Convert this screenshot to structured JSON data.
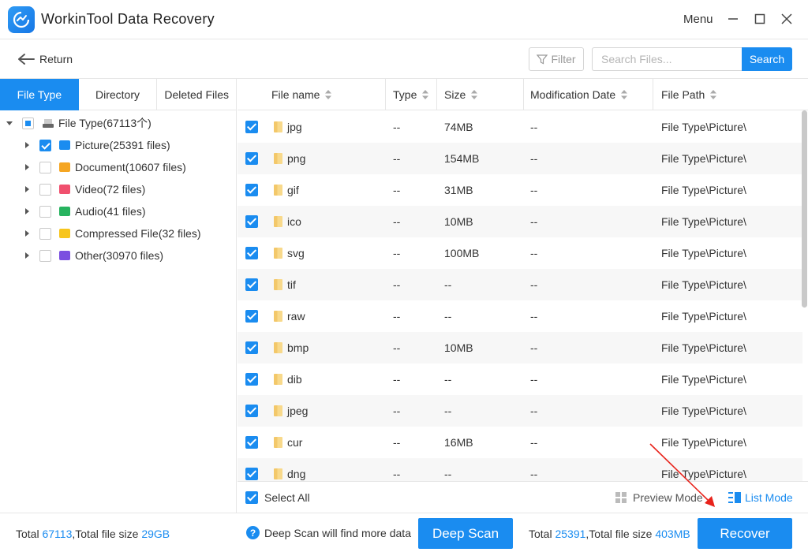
{
  "app": {
    "title": "WorkinTool Data Recovery",
    "menu_label": "Menu"
  },
  "toolbar": {
    "return_label": "Return",
    "filter_label": "Filter",
    "search_placeholder": "Search Files...",
    "search_label": "Search"
  },
  "tabs": [
    {
      "label": "File Type",
      "active": true
    },
    {
      "label": "Directory",
      "active": false
    },
    {
      "label": "Deleted Files",
      "active": false
    }
  ],
  "tree": {
    "root_label": "File Type(67113个)",
    "items": [
      {
        "label": "Picture(25391 files)",
        "checked": true,
        "icon": "picture-icon",
        "color": "#1a8cf0"
      },
      {
        "label": "Document(10607 files)",
        "checked": false,
        "icon": "document-icon",
        "color": "#f5a623"
      },
      {
        "label": "Video(72 files)",
        "checked": false,
        "icon": "video-icon",
        "color": "#f0506e"
      },
      {
        "label": "Audio(41 files)",
        "checked": false,
        "icon": "audio-icon",
        "color": "#27b35f"
      },
      {
        "label": "Compressed File(32 files)",
        "checked": false,
        "icon": "zip-icon",
        "color": "#f7c51c"
      },
      {
        "label": "Other(30970 files)",
        "checked": false,
        "icon": "other-icon",
        "color": "#7b4fe0"
      }
    ]
  },
  "table": {
    "columns": [
      "File name",
      "Type",
      "Size",
      "Modification Date",
      "File Path"
    ],
    "rows": [
      {
        "name": "jpg",
        "type": "--",
        "size": "74MB",
        "date": "--",
        "path": "File Type\\Picture\\"
      },
      {
        "name": "png",
        "type": "--",
        "size": "154MB",
        "date": "--",
        "path": "File Type\\Picture\\"
      },
      {
        "name": "gif",
        "type": "--",
        "size": "31MB",
        "date": "--",
        "path": "File Type\\Picture\\"
      },
      {
        "name": "ico",
        "type": "--",
        "size": "10MB",
        "date": "--",
        "path": "File Type\\Picture\\"
      },
      {
        "name": "svg",
        "type": "--",
        "size": "100MB",
        "date": "--",
        "path": "File Type\\Picture\\"
      },
      {
        "name": "tif",
        "type": "--",
        "size": "--",
        "date": "--",
        "path": "File Type\\Picture\\"
      },
      {
        "name": "raw",
        "type": "--",
        "size": "--",
        "date": "--",
        "path": "File Type\\Picture\\"
      },
      {
        "name": "bmp",
        "type": "--",
        "size": "10MB",
        "date": "--",
        "path": "File Type\\Picture\\"
      },
      {
        "name": "dib",
        "type": "--",
        "size": "--",
        "date": "--",
        "path": "File Type\\Picture\\"
      },
      {
        "name": "jpeg",
        "type": "--",
        "size": "--",
        "date": "--",
        "path": "File Type\\Picture\\"
      },
      {
        "name": "cur",
        "type": "--",
        "size": "16MB",
        "date": "--",
        "path": "File Type\\Picture\\"
      },
      {
        "name": "dng",
        "type": "--",
        "size": "--",
        "date": "--",
        "path": "File Type\\Picture\\"
      }
    ]
  },
  "list_footer": {
    "select_all_label": "Select All",
    "preview_mode_label": "Preview Mode",
    "list_mode_label": "List Mode"
  },
  "bottom": {
    "total_prefix": "Total ",
    "total_count": "67113",
    "total_mid": ",Total file size ",
    "total_size": "29GB",
    "hint": "Deep Scan will find more data",
    "deep_scan_label": "Deep Scan",
    "sel_prefix": "Total ",
    "sel_count": "25391",
    "sel_mid": ",Total file size ",
    "sel_size": "403MB",
    "recover_label": "Recover"
  },
  "colors": {
    "accent": "#1a8cf0",
    "annotation_arrow": "#e8231b"
  }
}
